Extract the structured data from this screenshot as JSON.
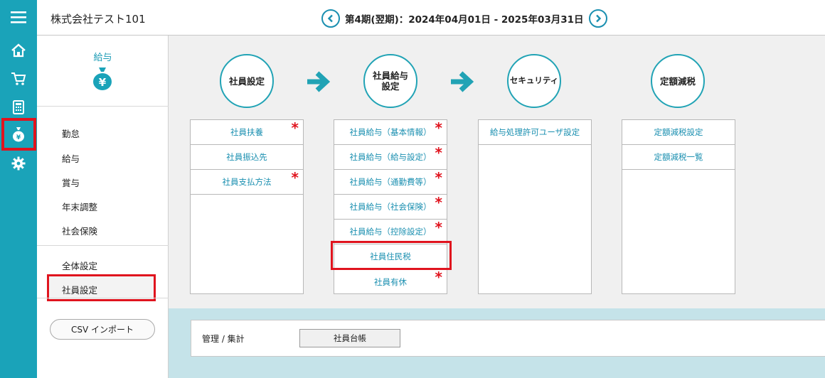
{
  "header": {
    "company": "株式会社テスト101",
    "period": "第4期(翌期)：2024年04月01日 - 2025年03月31日"
  },
  "rail": {
    "icons": [
      "menu-icon",
      "home-icon",
      "cart-icon",
      "calculator-icon",
      "money-bag-icon",
      "gear-icon"
    ],
    "active": "money-bag-icon"
  },
  "sidebar": {
    "title": "給与",
    "items": [
      "勤怠",
      "給与",
      "賞与",
      "年末調整",
      "社会保険"
    ],
    "settings": [
      "全体設定",
      "社員設定"
    ],
    "active_item": "社員設定",
    "csv_button": "CSV インポート"
  },
  "workflow": {
    "steps": [
      {
        "title": "社員設定",
        "rows": [
          {
            "label": "社員扶養",
            "required": true
          },
          {
            "label": "社員振込先",
            "required": false
          },
          {
            "label": "社員支払方法",
            "required": true
          }
        ]
      },
      {
        "title": "社員給与\n設定",
        "rows": [
          {
            "label": "社員給与（基本情報）",
            "required": true
          },
          {
            "label": "社員給与（給与設定）",
            "required": true
          },
          {
            "label": "社員給与（通勤費等）",
            "required": true
          },
          {
            "label": "社員給与（社会保険）",
            "required": true
          },
          {
            "label": "社員給与（控除設定）",
            "required": true
          },
          {
            "label": "社員住民税",
            "required": false
          },
          {
            "label": "社員有休",
            "required": true
          }
        ]
      },
      {
        "title": "セキュリティ",
        "rows": [
          {
            "label": "給与処理許可ユーザ設定",
            "required": false
          }
        ]
      },
      {
        "title": "定額減税",
        "rows": [
          {
            "label": "定額減税設定",
            "required": false
          },
          {
            "label": "定額減税一覧",
            "required": false
          }
        ]
      }
    ],
    "required_mark": "*"
  },
  "bottom": {
    "label": "管理 / 集計",
    "button": "社員台帳"
  },
  "colors": {
    "accent": "#1aa3b9",
    "link": "#1a8fb0",
    "highlight": "#e0141e"
  }
}
